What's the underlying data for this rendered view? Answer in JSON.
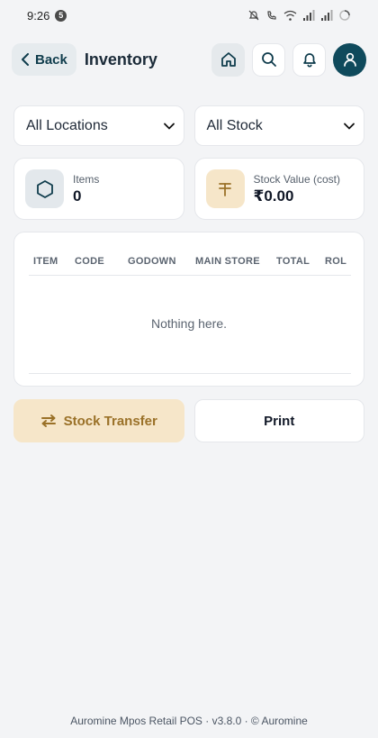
{
  "status_bar": {
    "time": "9:26",
    "notification_count": "5"
  },
  "header": {
    "back_label": "Back",
    "title": "Inventory"
  },
  "filters": {
    "location": "All Locations",
    "stock": "All Stock"
  },
  "stats": {
    "items_label": "Items",
    "items_value": "0",
    "stock_value_label": "Stock Value (cost)",
    "stock_value_value": "₹0.00"
  },
  "table": {
    "columns": [
      "ITEM",
      "CODE",
      "GODOWN",
      "MAIN STORE",
      "TOTAL",
      "ROL"
    ],
    "empty_message": "Nothing here."
  },
  "actions": {
    "transfer_label": "Stock Transfer",
    "print_label": "Print"
  },
  "footer": {
    "text": "Auromine Mpos Retail POS · v3.8.0 · © Auromine"
  },
  "colors": {
    "accent": "#0f4a5c",
    "gold": "#9a7128",
    "gold_bg": "#f6e6c9",
    "background": "#f3f4f6"
  }
}
